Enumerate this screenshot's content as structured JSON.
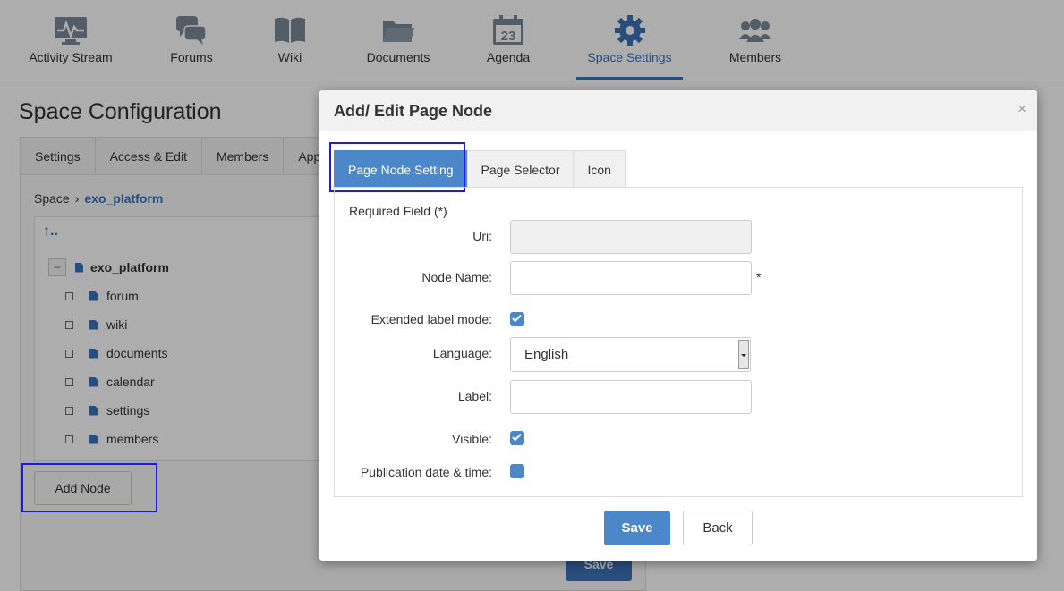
{
  "nav": {
    "items": [
      {
        "label": "Activity Stream",
        "icon": "activity-icon"
      },
      {
        "label": "Forums",
        "icon": "forums-icon"
      },
      {
        "label": "Wiki",
        "icon": "wiki-icon"
      },
      {
        "label": "Documents",
        "icon": "folder-icon"
      },
      {
        "label": "Agenda",
        "icon": "calendar-icon",
        "icon_text": "23"
      },
      {
        "label": "Space Settings",
        "icon": "gear-icon",
        "active": true
      },
      {
        "label": "Members",
        "icon": "members-icon"
      }
    ]
  },
  "page": {
    "title": "Space Configuration",
    "tabs": [
      "Settings",
      "Access & Edit",
      "Members",
      "App"
    ],
    "breadcrumb": {
      "root": "Space",
      "separator": "›",
      "current": "exo_platform"
    },
    "tree": {
      "up_label": "↑..",
      "collapse_symbol": "–",
      "root": "exo_platform",
      "children": [
        "forum",
        "wiki",
        "documents",
        "calendar",
        "settings",
        "members"
      ]
    },
    "add_node_label": "Add Node",
    "save_label": "Save"
  },
  "modal": {
    "title": "Add/ Edit Page Node",
    "close_symbol": "×",
    "tabs": [
      {
        "label": "Page Node Setting",
        "active": true
      },
      {
        "label": "Page Selector"
      },
      {
        "label": "Icon"
      }
    ],
    "form": {
      "required_note": "Required Field (*)",
      "uri_label": "Uri:",
      "uri_value": "",
      "node_name_label": "Node Name:",
      "node_name_value": "",
      "asterisk": "*",
      "extended_label": "Extended label mode:",
      "extended_checked": true,
      "language_label": "Language:",
      "language_value": "English",
      "label_label": "Label:",
      "label_value": "",
      "visible_label": "Visible:",
      "visible_checked": true,
      "publication_label": "Publication date & time:",
      "publication_checked": false
    },
    "save_label": "Save",
    "back_label": "Back"
  },
  "colors": {
    "accent": "#4c87c9",
    "nav_active": "#3b73b9",
    "highlight_box": "#1a1af0"
  }
}
